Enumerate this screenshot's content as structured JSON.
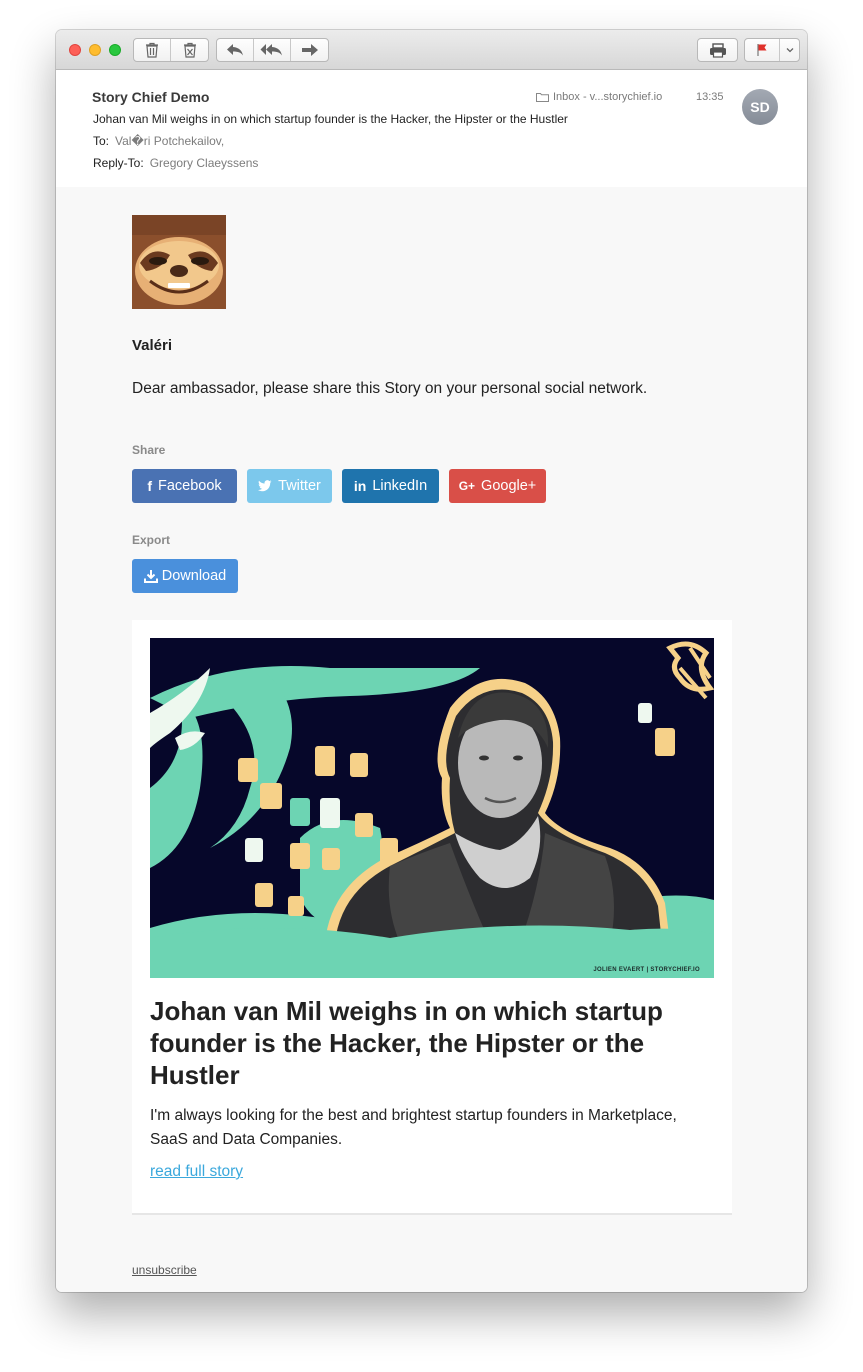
{
  "toolbar": {
    "buttons": [
      "trash-icon",
      "junk-icon",
      "reply-icon",
      "reply-all-icon",
      "forward-icon",
      "print-icon",
      "flag-icon",
      "chevron-down-icon"
    ],
    "flag_color": "#e0312b"
  },
  "email": {
    "sender": "Story Chief Demo",
    "subject": "Johan van Mil weighs in on which startup founder is the Hacker, the Hipster or the Hustler",
    "to_label": "To:",
    "to_value": "Val�ri Potchekailov,",
    "replyto_label": "Reply-To:",
    "replyto_value": "Gregory Claeyssens",
    "mailbox": "Inbox - v...storychief.io",
    "time": "13:35",
    "avatar_initials": "SD"
  },
  "body": {
    "username": "Valéri",
    "intro": "Dear ambassador, please share this Story on your personal social network.",
    "share_label": "Share",
    "export_label": "Export",
    "buttons": {
      "facebook": "Facebook",
      "twitter": "Twitter",
      "linkedin": "LinkedIn",
      "googleplus": "Google+",
      "download": "Download"
    },
    "button_colors": {
      "facebook": "#4a72b3",
      "twitter": "#7cc8ec",
      "linkedin": "#1f74ad",
      "googleplus": "#d94f48",
      "download": "#4a90dc"
    }
  },
  "story": {
    "image_credit": "JOLIEN EVAERT | STORYCHIEF.IO",
    "title": "Johan van Mil weighs in on which startup founder is the Hacker, the Hipster or the Hustler",
    "excerpt": "I'm always looking for the best and brightest startup founders in Marketplace, SaaS and Data Companies.",
    "link": "read full story"
  },
  "footer": {
    "unsubscribe": "unsubscribe"
  }
}
